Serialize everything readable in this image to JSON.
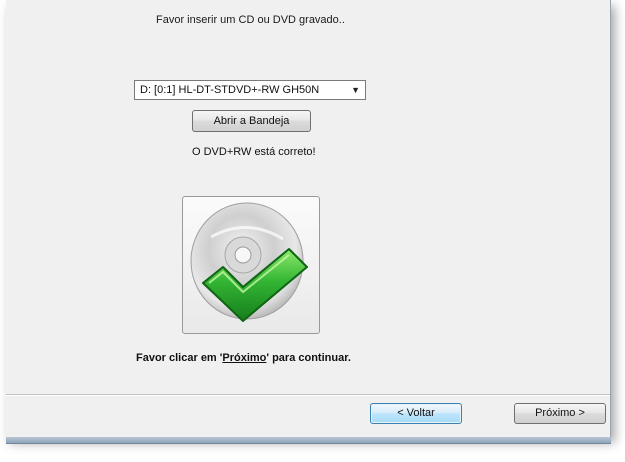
{
  "wizard": {
    "instruction": "Favor inserir um CD ou DVD gravado..",
    "drive_select": {
      "selected": "D: [0:1] HL-DT-STDVD+-RW GH50N",
      "arrow_icon": "dropdown-arrow-icon"
    },
    "open_tray_label": "Abrir a Bandeja",
    "status": "O DVD+RW está correto!",
    "disc_icon": "disc-check-icon",
    "continue_prefix": "Favor clicar em '",
    "continue_link": "Próximo",
    "continue_suffix": "' para continuar."
  },
  "footer": {
    "back_label": "< Voltar",
    "next_label": "Próximo >"
  },
  "colors": {
    "check_green": "#33b533",
    "focus_blue": "#3c7fb1"
  }
}
